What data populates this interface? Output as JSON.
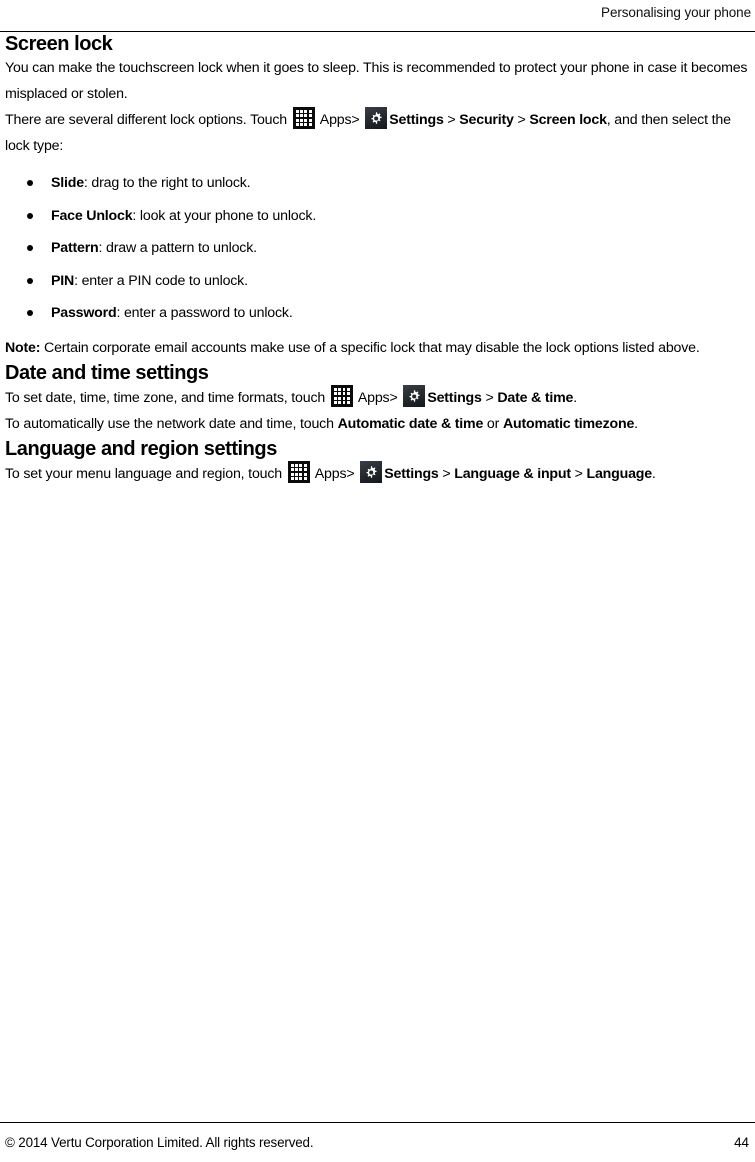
{
  "header": {
    "title": "Personalising your phone"
  },
  "icons": {
    "apps": "apps-grid-icon",
    "settings": "gear-icon"
  },
  "sections": {
    "screen_lock": {
      "heading": "Screen lock",
      "intro": "You can make the touchscreen lock when it goes to sleep. This is recommended to protect your phone in case it becomes misplaced or stolen.",
      "path_intro_a": "There are several different lock options. Touch",
      "path_apps_label": "Apps",
      "path_sep": ">",
      "path_settings_label": "Settings",
      "path_security_label": "Security",
      "path_screen_lock_label": "Screen lock",
      "path_tail": ", and then select the lock type:",
      "options": [
        {
          "term": "Slide",
          "desc": ": drag to the right to unlock."
        },
        {
          "term": "Face Unlock",
          "desc": ": look at your phone to unlock."
        },
        {
          "term": "Pattern",
          "desc": ": draw a pattern to unlock."
        },
        {
          "term": "PIN",
          "desc": ": enter a PIN code to unlock."
        },
        {
          "term": "Password",
          "desc": ": enter a password to unlock."
        }
      ],
      "note_label": "Note:",
      "note_text": " Certain corporate email accounts make use of a specific lock that may disable the lock options listed above."
    },
    "date_time": {
      "heading": "Date and time settings",
      "line1_a": "To set date, time, time zone, and time formats, touch",
      "apps_label": "Apps",
      "sep": ">",
      "settings_label": "Settings",
      "date_time_label": "Date & time",
      "line1_tail": ".",
      "line2_a": "To automatically use the network date and time, touch",
      "auto_date_time_label": "Automatic date & time",
      "line2_or": " or ",
      "auto_timezone_label": "Automatic timezone",
      "line2_tail": "."
    },
    "language": {
      "heading": "Language and region settings",
      "line1_a": "To set your menu language and region, touch",
      "apps_label": "Apps",
      "sep": ">",
      "settings_label": "Settings",
      "language_input_label": "Language & input",
      "language_label": "Language",
      "line1_tail": "."
    }
  },
  "footer": {
    "copyright": "© 2014 Vertu Corporation Limited. All rights reserved.",
    "page_number": "44"
  },
  "colors": {
    "text": "#000000",
    "rule": "#000000",
    "icon_apps_bg": "#0b0b0b",
    "icon_settings_bg": "#24282d"
  }
}
